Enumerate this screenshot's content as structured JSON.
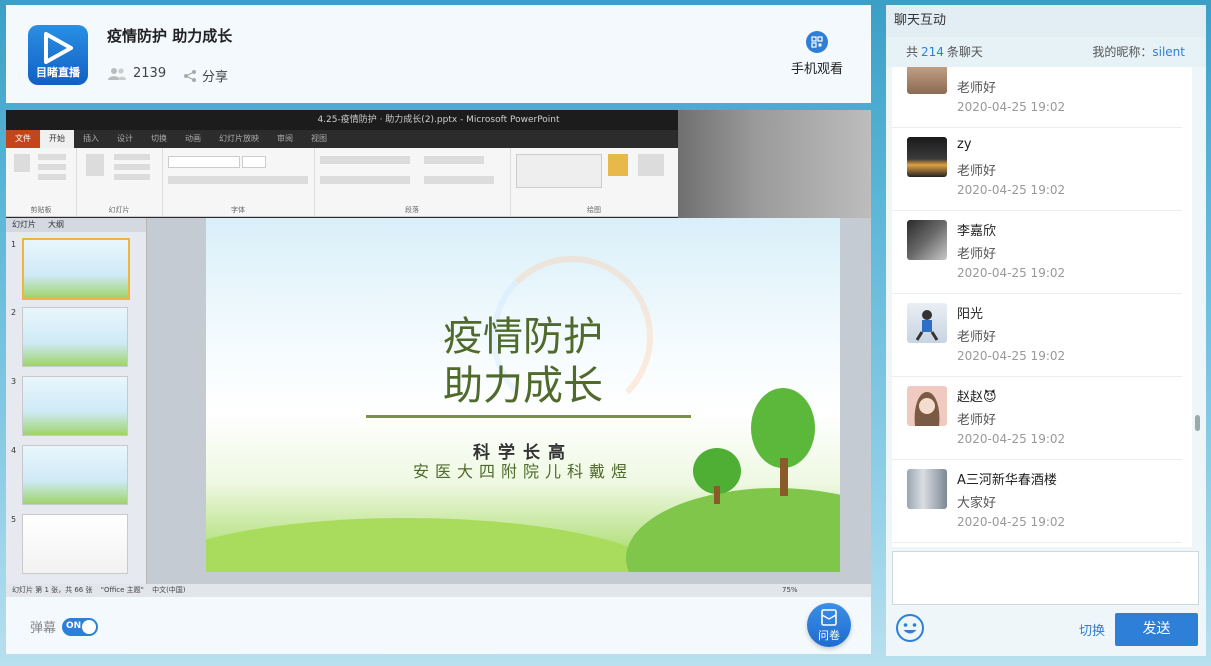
{
  "header": {
    "logo_text": "目睹直播",
    "title": "疫情防护 助力成长",
    "viewers": "2139",
    "share_label": "分享",
    "mobile_label": "手机观看"
  },
  "video": {
    "ppt_window_title": "4.25-疫情防护 · 助力成长(2).pptx - Microsoft PowerPoint",
    "ribbon_tabs": [
      "文件",
      "开始",
      "插入",
      "设计",
      "切换",
      "动画",
      "幻灯片放映",
      "审阅",
      "视图"
    ],
    "ribbon_groups": [
      "剪贴板",
      "幻灯片",
      "字体",
      "段落",
      "绘图"
    ],
    "panel_tabs": [
      "幻灯片",
      "大纲"
    ],
    "slide": {
      "title_line1": "疫情防护",
      "title_line2": "助力成长",
      "subtitle1": "科学长高",
      "subtitle2": "安医大四附院儿科戴煜"
    },
    "thumb_numbers": [
      "1",
      "2",
      "3",
      "4",
      "5"
    ],
    "status": {
      "slide_info": "幻灯片 第 1 张，共 66 张",
      "theme": "\"Office 主题\"",
      "lang": "中文(中国)",
      "zoom": "75%"
    }
  },
  "bottom": {
    "danmu_label": "弹幕",
    "toggle_label": "ON",
    "survey_label": "问卷"
  },
  "chat": {
    "header": "聊天互动",
    "count_prefix": "共",
    "count": "214",
    "count_suffix": "条聊天",
    "nickname_label": "我的昵称：",
    "nickname": "silent",
    "messages": [
      {
        "name": "",
        "text": "老师好",
        "time": "2020-04-25 19:02"
      },
      {
        "name": "zy",
        "text": "老师好",
        "time": "2020-04-25 19:02"
      },
      {
        "name": "李嘉欣",
        "text": "老师好",
        "time": "2020-04-25 19:02"
      },
      {
        "name": "阳光",
        "text": "老师好",
        "time": "2020-04-25 19:02"
      },
      {
        "name": "赵赵😈",
        "text": "老师好",
        "time": "2020-04-25 19:02"
      },
      {
        "name": "A三河新华春酒楼",
        "text": "大家好",
        "time": "2020-04-25 19:02"
      }
    ],
    "switch_label": "切换",
    "send_label": "发送"
  }
}
